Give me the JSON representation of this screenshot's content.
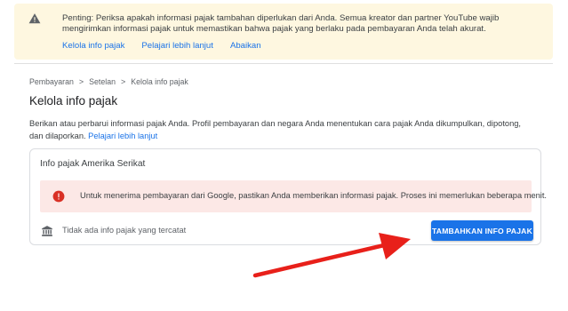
{
  "banner": {
    "text": "Penting: Periksa apakah informasi pajak tambahan diperlukan dari Anda. Semua kreator dan partner YouTube wajib mengirimkan informasi pajak untuk memastikan bahwa pajak yang berlaku pada pembayaran Anda telah akurat.",
    "links": [
      "Kelola info pajak",
      "Pelajari lebih lanjut",
      "Abaikan"
    ],
    "icon": "warning-icon",
    "color": "#fef7e0"
  },
  "breadcrumb": {
    "items": [
      "Pembayaran",
      "Setelan",
      "Kelola info pajak"
    ],
    "separator": ">"
  },
  "page": {
    "title": "Kelola info pajak",
    "description": "Berikan atau perbarui informasi pajak Anda. Profil pembayaran dan negara Anda menentukan cara pajak Anda dikumpulkan, dipotong, dan dilaporkan.",
    "learn_more": "Pelajari lebih lanjut"
  },
  "card": {
    "title": "Info pajak Amerika Serikat",
    "alert": {
      "text": "Untuk menerima pembayaran dari Google, pastikan Anda memberikan informasi pajak. Proses ini memerlukan beberapa menit.",
      "icon": "error-icon",
      "color": "#fce8e6"
    },
    "empty_text": "Tidak ada info pajak yang tercatat",
    "add_button": "TAMBAHKAN INFO PAJAK"
  },
  "colors": {
    "accent": "#1a73e8",
    "error": "#d93025",
    "annotation_arrow": "#e8201a"
  }
}
